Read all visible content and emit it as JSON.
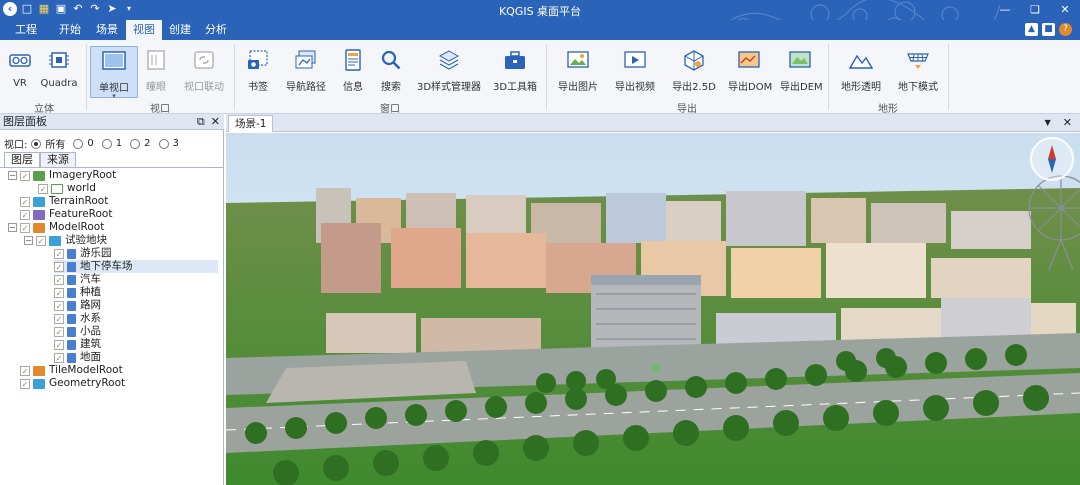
{
  "titlebar": {
    "title": "KQGIS 桌面平台"
  },
  "menu": {
    "tabs": [
      "工程",
      "开始",
      "场景",
      "视图",
      "创建",
      "分析"
    ],
    "active": "视图"
  },
  "ribbon": {
    "groups": [
      {
        "label": "立体",
        "buttons": [
          "VR",
          "Quadra"
        ]
      },
      {
        "label": "视口",
        "buttons": [
          "单视口",
          "瞳眼",
          "视口联动"
        ]
      },
      {
        "label": "窗口",
        "buttons": [
          "书签",
          "导航路径",
          "信息",
          "搜索",
          "3D样式管理器",
          "3D工具箱"
        ]
      },
      {
        "label": "导出",
        "buttons": [
          "导出图片",
          "导出视频",
          "导出2.5D",
          "导出DOM",
          "导出DEM"
        ]
      },
      {
        "label": "地形",
        "buttons": [
          "地形透明",
          "地下模式"
        ]
      }
    ]
  },
  "panel": {
    "title": "图层面板",
    "viewport_label": "视口:",
    "viewport_options": [
      "所有",
      "0",
      "1",
      "2",
      "3"
    ],
    "tabs": [
      "图层",
      "来源"
    ],
    "tree": [
      "ImageryRoot",
      "world",
      "TerrainRoot",
      "FeatureRoot",
      "ModelRoot",
      "试验地块",
      "游乐园",
      "地下停车场",
      "汽车",
      "种植",
      "路网",
      "水系",
      "小品",
      "建筑",
      "地面",
      "TileModelRoot",
      "GeometryRoot"
    ]
  },
  "document": {
    "tab": "场景-1"
  },
  "colors": {
    "accent": "#2b63b8",
    "ribbon_bg": "#f4f6fa",
    "selected": "#cde0f7"
  }
}
